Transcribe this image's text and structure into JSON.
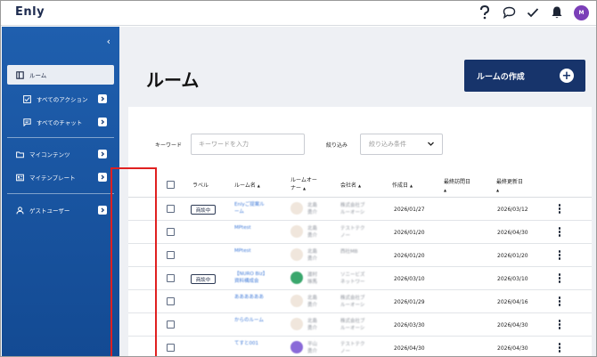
{
  "app": {
    "logo": "Enly",
    "avatar_initial": "M",
    "colors": {
      "sidebar": "#1f5fae",
      "primary_button": "#17346b",
      "avatar": "#7b3fb8",
      "highlight": "#e02020",
      "link": "#3f7ad8"
    }
  },
  "header_icons": [
    "help-icon",
    "chat-icon",
    "check-icon",
    "bell-icon",
    "avatar"
  ],
  "sidebar": {
    "collapse": "‹",
    "items": [
      {
        "label": "ルーム",
        "icon": "room-icon",
        "active": true
      },
      {
        "label": "すべてのアクション",
        "icon": "checkbox-icon",
        "sub": true
      },
      {
        "label": "すべてのチャット",
        "icon": "chat-icon",
        "sub": true
      },
      {
        "label": "マイコンテンツ",
        "icon": "folder-icon"
      },
      {
        "label": "マイテンプレート",
        "icon": "template-icon"
      },
      {
        "label": "ゲストユーザー",
        "icon": "user-icon"
      }
    ]
  },
  "page": {
    "title": "ルーム",
    "create_button": "ルームの作成"
  },
  "filters": {
    "keyword_label": "キーワード",
    "keyword_placeholder": "キーワードを入力",
    "narrow_label": "絞り込み",
    "narrow_placeholder": "絞り込み条件"
  },
  "table": {
    "headers": {
      "label": "ラベル",
      "room_name": "ルーム名",
      "owner_line1": "ルームオー",
      "owner_line2": "ナー",
      "company": "会社名",
      "created": "作成日",
      "last_visit": "最終訪問日",
      "last_update": "最終更新日"
    },
    "sort_icon": "▲",
    "rows": [
      {
        "badge": "商談中",
        "room_l1": "Enlyご提案ル",
        "room_l2": "ーム",
        "owner_l1": "北島",
        "owner_l2": "勇介",
        "company_l1": "株式会社ブ",
        "company_l2": "ルーオーシ",
        "created": "2026/01/27",
        "updated": "2026/03/12"
      },
      {
        "badge": "",
        "room_l1": "MPtest",
        "room_l2": "",
        "owner_l1": "北島",
        "owner_l2": "勇介",
        "company_l1": "テストテク",
        "company_l2": "ノー",
        "created": "2026/01/20",
        "updated": "2026/04/30"
      },
      {
        "badge": "",
        "room_l1": "MPtest",
        "room_l2": "",
        "owner_l1": "北島",
        "owner_l2": "勇介",
        "company_l1": "西社MB",
        "company_l2": "",
        "created": "2026/01/20",
        "updated": "2026/01/20"
      },
      {
        "badge": "商談中",
        "room_l1": "【NURO Biz】",
        "room_l2": "資料構成会",
        "owner_l1": "渡村",
        "owner_l2": "琢馬",
        "company_l1": "ソニービズ",
        "company_l2": "ネットワー",
        "created": "2026/03/10",
        "updated": "2026/03/10"
      },
      {
        "badge": "",
        "room_l1": "ああああああ",
        "room_l2": "",
        "owner_l1": "北島",
        "owner_l2": "勇介",
        "company_l1": "株式会社ブ",
        "company_l2": "ルーオーシ",
        "created": "2026/01/29",
        "updated": "2026/04/16"
      },
      {
        "badge": "",
        "room_l1": "からのルーム",
        "room_l2": "",
        "owner_l1": "北島",
        "owner_l2": "勇介",
        "company_l1": "株式会社ブ",
        "company_l2": "ルーオーシ",
        "created": "2026/03/30",
        "updated": "2026/04/30"
      },
      {
        "badge": "",
        "room_l1": "てすと001",
        "room_l2": "",
        "owner_l1": "平山",
        "owner_l2": "勇介",
        "company_l1": "テストテク",
        "company_l2": "ノー",
        "created": "2026/04/30",
        "updated": "2026/04/30"
      }
    ]
  }
}
